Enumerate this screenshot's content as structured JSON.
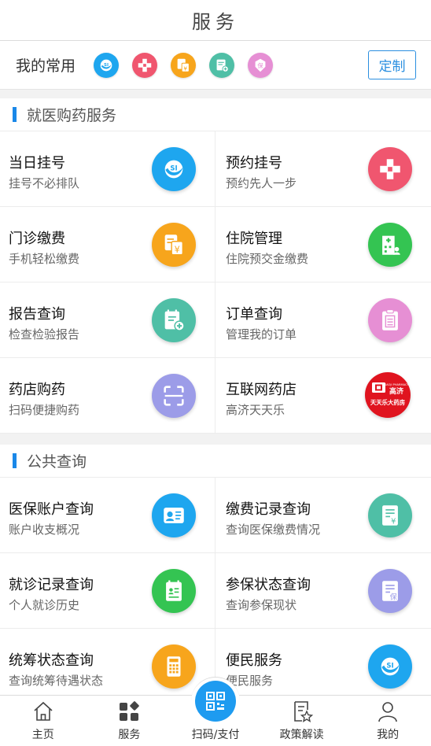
{
  "header": {
    "title": "服务"
  },
  "favorites": {
    "label": "我的常用",
    "icons": [
      "social-security-icon",
      "medical-cross-icon",
      "bill-icon",
      "report-icon",
      "insurance-icon"
    ],
    "customize_label": "定制"
  },
  "sections": [
    {
      "title": "就医购药服务",
      "items": [
        {
          "title": "当日挂号",
          "subtitle": "挂号不必排队",
          "icon": "social-security-icon",
          "color": "#1ea6ef"
        },
        {
          "title": "预约挂号",
          "subtitle": "预约先人一步",
          "icon": "medical-cross-icon",
          "color": "#f0566f"
        },
        {
          "title": "门诊缴费",
          "subtitle": "手机轻松缴费",
          "icon": "bill-icon",
          "color": "#f7a51c"
        },
        {
          "title": "住院管理",
          "subtitle": "住院预交金缴费",
          "icon": "hospital-icon",
          "color": "#34c452"
        },
        {
          "title": "报告查询",
          "subtitle": "检查检验报告",
          "icon": "report-icon",
          "color": "#4fbfa6"
        },
        {
          "title": "订单查询",
          "subtitle": "管理我的订单",
          "icon": "clipboard-icon",
          "color": "#e68fd4"
        },
        {
          "title": "药店购药",
          "subtitle": "扫码便捷购药",
          "icon": "scan-frame-icon",
          "color": "#9c9ce8"
        },
        {
          "title": "互联网药店",
          "subtitle": "高济天天乐",
          "icon": "pharmacy-logo-icon",
          "color": "#e0141f"
        }
      ]
    },
    {
      "title": "公共查询",
      "items": [
        {
          "title": "医保账户查询",
          "subtitle": "账户收支概况",
          "icon": "id-card-icon",
          "color": "#1ea6ef"
        },
        {
          "title": "缴费记录查询",
          "subtitle": "查询医保缴费情况",
          "icon": "payment-record-icon",
          "color": "#4fbfa6"
        },
        {
          "title": "就诊记录查询",
          "subtitle": "个人就诊历史",
          "icon": "visit-record-icon",
          "color": "#34c452"
        },
        {
          "title": "参保状态查询",
          "subtitle": "查询参保现状",
          "icon": "insurance-doc-icon",
          "color": "#9c9ce8"
        },
        {
          "title": "统筹状态查询",
          "subtitle": "查询统筹待遇状态",
          "icon": "calculator-icon",
          "color": "#f7a51c"
        },
        {
          "title": "便民服务",
          "subtitle": "便民服务",
          "icon": "social-security-icon",
          "color": "#1ea6ef"
        }
      ]
    }
  ],
  "pharmacy_logo": {
    "top_text": "GAOJI PHARMACY",
    "brand": "高济",
    "name": "天天乐大药房"
  },
  "tabbar": [
    {
      "label": "主页",
      "icon": "home-icon"
    },
    {
      "label": "服务",
      "icon": "grid-icon"
    },
    {
      "label": "扫码/支付",
      "icon": "qr-code-icon"
    },
    {
      "label": "政策解读",
      "icon": "policy-doc-icon"
    },
    {
      "label": "我的",
      "icon": "user-icon"
    }
  ],
  "colors": {
    "accent": "#1a88e8",
    "button_border": "#2b8fe0",
    "tab_center": "#1e9bf0"
  }
}
